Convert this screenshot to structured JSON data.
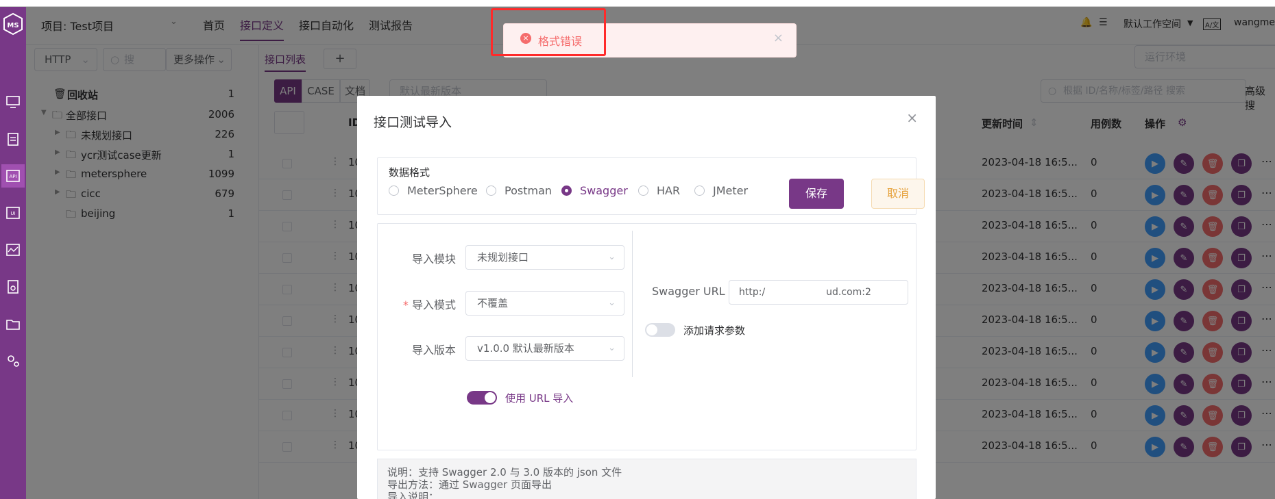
{
  "header": {
    "project": "项目: Test项目",
    "tabs": [
      "首页",
      "接口定义",
      "接口自动化",
      "测试报告"
    ],
    "workspace": "默认工作空间",
    "lang_badge": "A/文",
    "user": "wangmeiji"
  },
  "toolbar": {
    "protocol": "HTTP",
    "search_placeholder": "搜",
    "more_ops": "更多操作",
    "list_tab": "接口列表",
    "add": "+",
    "run_env_placeholder": "运行环境",
    "view_api": "API",
    "view_case": "CASE",
    "view_doc": "文档",
    "version_placeholder": "默认最新版本",
    "search_main_placeholder": "根据 ID/名称/标签/路径 搜索",
    "advanced": "高级搜"
  },
  "tree": {
    "recycle": {
      "label": "回收站",
      "count": "1"
    },
    "root": {
      "label": "全部接口",
      "count": "2006"
    },
    "children": [
      {
        "label": "未规划接口",
        "count": "226"
      },
      {
        "label": "ycr测试case更新",
        "count": "1"
      },
      {
        "label": "metersphere",
        "count": "1099"
      },
      {
        "label": "cicc",
        "count": "679"
      },
      {
        "label": "beijing",
        "count": "1"
      }
    ]
  },
  "table": {
    "col_id": "ID",
    "col_update": "更新时间",
    "col_cases": "用例数",
    "col_ops": "操作",
    "rows": [
      {
        "id": "10",
        "time": "2023-04-18 16:5...",
        "cases": "0"
      },
      {
        "id": "10",
        "time": "2023-04-18 16:5...",
        "cases": "0"
      },
      {
        "id": "10",
        "time": "2023-04-18 16:5...",
        "cases": "0"
      },
      {
        "id": "10",
        "time": "2023-04-18 16:5...",
        "cases": "0"
      },
      {
        "id": "10",
        "time": "2023-04-18 16:5...",
        "cases": "0"
      },
      {
        "id": "10",
        "time": "2023-04-18 16:5...",
        "cases": "0"
      },
      {
        "id": "10",
        "time": "2023-04-18 16:5...",
        "cases": "0"
      },
      {
        "id": "10",
        "time": "2023-04-18 16:5...",
        "cases": "0"
      },
      {
        "id": "10",
        "time": "2023-04-18 16:5...",
        "cases": "0"
      },
      {
        "id": "10",
        "time": "2023-04-18 16:5...",
        "cases": "0"
      }
    ]
  },
  "toast": {
    "message": "格式错误",
    "close": "×"
  },
  "modal": {
    "title": "接口测试导入",
    "close": "×",
    "format_label": "数据格式",
    "formats": [
      "MeterSphere",
      "Postman",
      "Swagger",
      "HAR",
      "JMeter"
    ],
    "selected_format": "Swagger",
    "save": "保存",
    "cancel": "取消",
    "module_label": "导入模块",
    "module_value": "未规划接口",
    "mode_label": "导入模式",
    "mode_value": "不覆盖",
    "version_label": "导入版本",
    "version_value": "v1.0.0 默认最新版本",
    "use_url_label": "使用 URL 导入",
    "use_url_on": true,
    "swagger_url_label": "Swagger URL",
    "swagger_url_value": "http:/                    ud.com:2",
    "add_params_label": "添加请求参数",
    "add_params_on": false,
    "note_lines": [
      "说明：支持 Swagger 2.0 与 3.0 版本的 json 文件",
      "导出方法：通过 Swagger 页面导出",
      "导入说明："
    ]
  },
  "colors": {
    "primary": "#783887",
    "danger": "#f56c6c",
    "info": "#409eff",
    "warning": "#e6a23c"
  }
}
